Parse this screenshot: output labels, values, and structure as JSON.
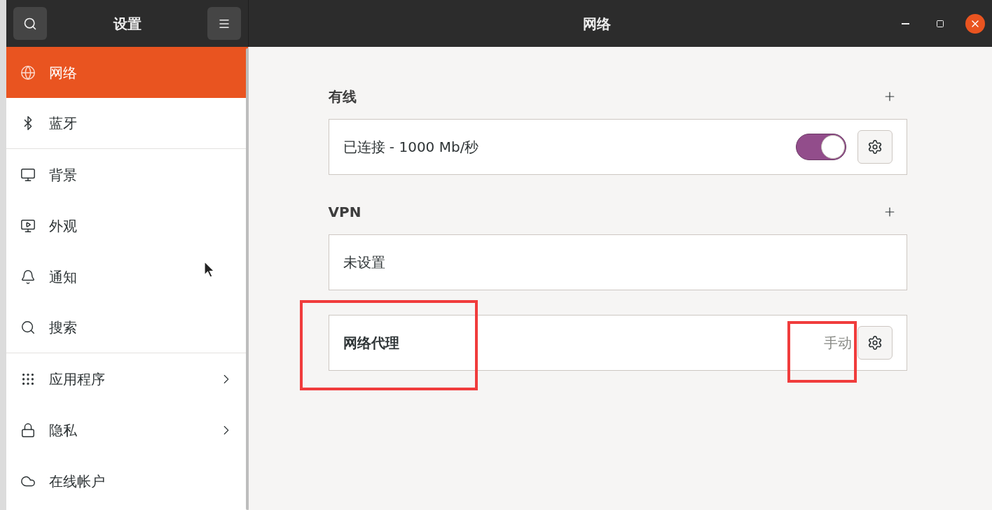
{
  "sidebar": {
    "title": "设置",
    "items": [
      {
        "label": "网络",
        "selected": true,
        "kind": "page"
      },
      {
        "label": "蓝牙",
        "selected": false,
        "kind": "page"
      },
      {
        "label": "背景",
        "selected": false,
        "kind": "page"
      },
      {
        "label": "外观",
        "selected": false,
        "kind": "page"
      },
      {
        "label": "通知",
        "selected": false,
        "kind": "page"
      },
      {
        "label": "搜索",
        "selected": false,
        "kind": "page"
      },
      {
        "label": "应用程序",
        "selected": false,
        "kind": "submenu"
      },
      {
        "label": "隐私",
        "selected": false,
        "kind": "submenu"
      },
      {
        "label": "在线帐户",
        "selected": false,
        "kind": "page"
      }
    ]
  },
  "window": {
    "title": "网络"
  },
  "sections": [
    {
      "heading": "有线",
      "rows": [
        {
          "kind": "switch",
          "label": "已连接 - 1000 Mb/秒",
          "on": true
        }
      ]
    },
    {
      "heading": "VPN",
      "rows": [
        {
          "kind": "plain",
          "label": "未设置"
        }
      ]
    },
    {
      "rows": [
        {
          "kind": "proxy",
          "label": "网络代理",
          "value": "手动"
        }
      ]
    }
  ]
}
